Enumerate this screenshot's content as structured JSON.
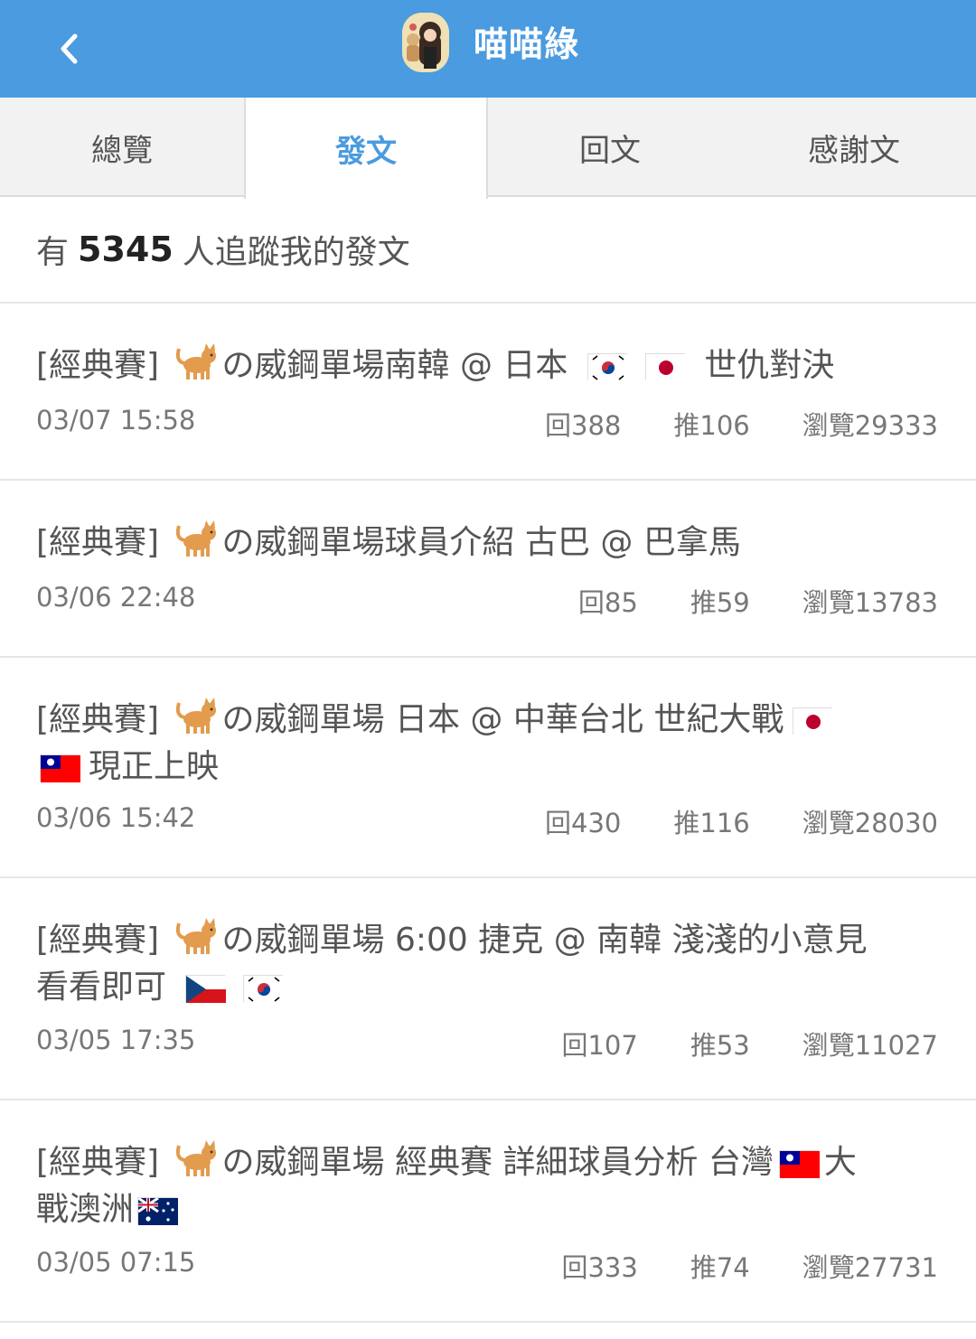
{
  "header": {
    "title": "喵喵綠",
    "back_icon": "chevron-left-icon",
    "avatar_icon": "avatar"
  },
  "colors": {
    "accent": "#4a9be0",
    "header_text": "#ffffff",
    "tab_bg": "#f2f2f2"
  },
  "tabs": [
    {
      "label": "總覽",
      "active": false
    },
    {
      "label": "發文",
      "active": true
    },
    {
      "label": "回文",
      "active": false
    },
    {
      "label": "感謝文",
      "active": false
    }
  ],
  "follow": {
    "prefix": "有",
    "count": "5345",
    "suffix": "人追蹤我的發文"
  },
  "posts": [
    {
      "tag": "[經典賽]",
      "line1_a": "の威鋼單場南韓 @ 日本",
      "line1_b": "世仇對決",
      "time": "03/07 15:58",
      "replies": "回388",
      "pushes": "推106",
      "views": "瀏覽29333"
    },
    {
      "tag": "[經典賽]",
      "line1_a": "の威鋼單場球員介紹 古巴 @ 巴拿馬",
      "time": "03/06 22:48",
      "replies": "回85",
      "pushes": "推59",
      "views": "瀏覽13783"
    },
    {
      "tag": "[經典賽]",
      "line1_a": "の威鋼單場 日本 @ 中華台北 世紀大戰",
      "line2_a": "現正上映",
      "time": "03/06 15:42",
      "replies": "回430",
      "pushes": "推116",
      "views": "瀏覽28030"
    },
    {
      "tag": "[經典賽]",
      "line1_a": "の威鋼單場 6:00 捷克 @ 南韓 淺淺的小意見",
      "line2_a": "看看即可",
      "time": "03/05 17:35",
      "replies": "回107",
      "pushes": "推53",
      "views": "瀏覽11027"
    },
    {
      "tag": "[經典賽]",
      "line1_a": "の威鋼單場 經典賽 詳細球員分析 台灣",
      "line1_b": "大",
      "line2_a": "戰澳洲",
      "time": "03/05 07:15",
      "replies": "回333",
      "pushes": "推74",
      "views": "瀏覽27731"
    }
  ]
}
